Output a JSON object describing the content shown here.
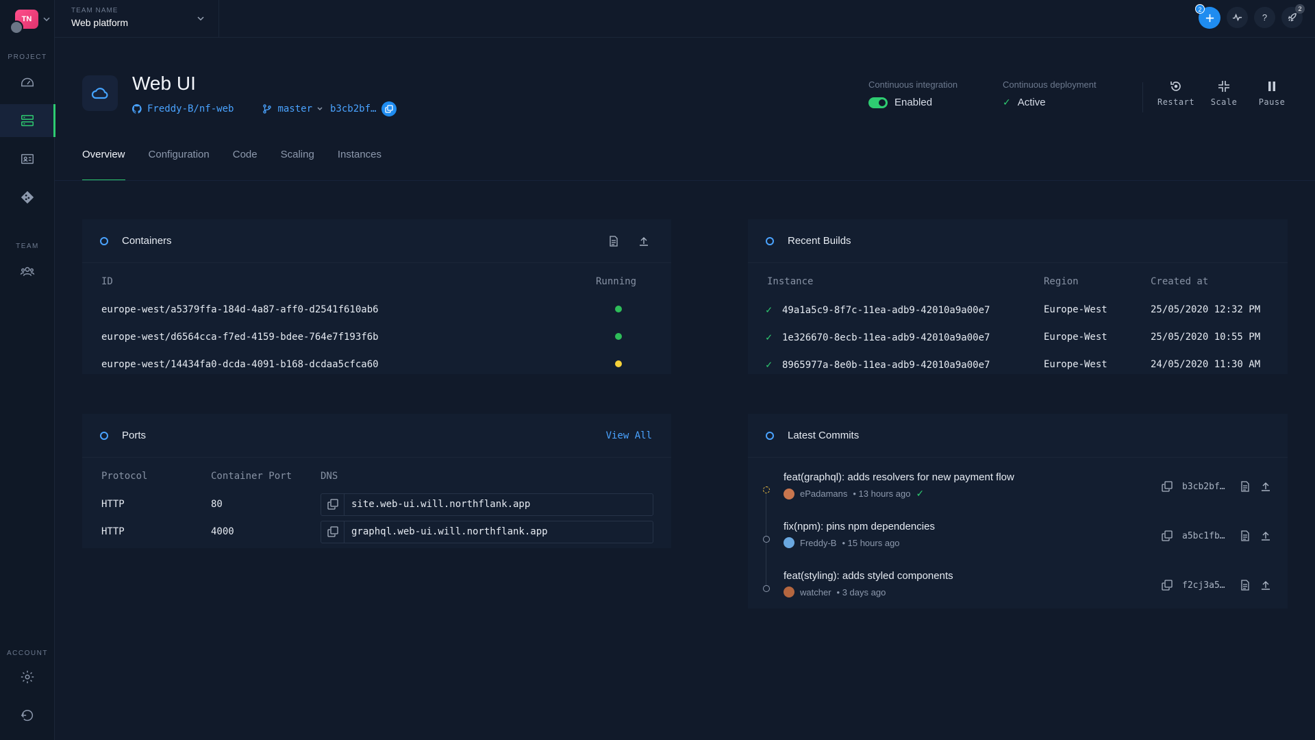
{
  "sidebar": {
    "team_initials": "TN",
    "project_label": "PROJECT",
    "team_label": "TEAM",
    "account_label": "ACCOUNT"
  },
  "topbar": {
    "team_name_label": "TEAM NAME",
    "team_name": "Web platform",
    "add_badge": "2",
    "help_glyph": "?",
    "notifications_badge": "2"
  },
  "service": {
    "title": "Web UI",
    "repo": "Freddy-B/nf-web",
    "branch": "master",
    "commit": "b3cb2bf…"
  },
  "status": {
    "ci_label": "Continuous integration",
    "ci_value": "Enabled",
    "cd_label": "Continuous deployment",
    "cd_value": "Active",
    "check_mark": "✓"
  },
  "header_actions": {
    "restart": "Restart",
    "scale": "Scale",
    "pause": "Pause"
  },
  "tabs": [
    {
      "label": "Overview",
      "active": true
    },
    {
      "label": "Configuration"
    },
    {
      "label": "Code"
    },
    {
      "label": "Scaling"
    },
    {
      "label": "Instances"
    }
  ],
  "containers": {
    "title": "Containers",
    "col_id": "ID",
    "col_running": "Running",
    "rows": [
      {
        "id": "europe-west/a5379ffa-184d-4a87-aff0-d2541f610ab6",
        "status_color": "#2ebd59"
      },
      {
        "id": "europe-west/d6564cca-f7ed-4159-bdee-764e7f193f6b",
        "status_color": "#2ebd59"
      },
      {
        "id": "europe-west/14434fa0-dcda-4091-b168-dcdaa5cfca60",
        "status_color": "#f5d13a"
      }
    ]
  },
  "ports": {
    "title": "Ports",
    "view_all": "View All",
    "col_protocol": "Protocol",
    "col_port": "Container Port",
    "col_dns": "DNS",
    "rows": [
      {
        "protocol": "HTTP",
        "port": "80",
        "dns": "site.web-ui.will.northflank.app"
      },
      {
        "protocol": "HTTP",
        "port": "4000",
        "dns": "graphql.web-ui.will.northflank.app"
      }
    ]
  },
  "builds": {
    "title": "Recent Builds",
    "col_instance": "Instance",
    "col_region": "Region",
    "col_created": "Created at",
    "check_mark": "✓",
    "rows": [
      {
        "instance": "49a1a5c9-8f7c-11ea-adb9-42010a9a00e7",
        "region": "Europe-West",
        "created": "25/05/2020 12:32 PM"
      },
      {
        "instance": "1e326670-8ecb-11ea-adb9-42010a9a00e7",
        "region": "Europe-West",
        "created": "25/05/2020 10:55 PM"
      },
      {
        "instance": "8965977a-8e0b-11ea-adb9-42010a9a00e7",
        "region": "Europe-West",
        "created": "24/05/2020 11:30 AM"
      }
    ]
  },
  "commits": {
    "title": "Latest Commits",
    "check_mark": "✓",
    "rows": [
      {
        "message": "feat(graphql): adds resolvers for new payment flow",
        "author": "ePadamans",
        "time": "• 13 hours ago",
        "sha": "b3cb2bf…",
        "avatar_color": "#c9764e"
      },
      {
        "message": "fix(npm): pins npm dependencies",
        "author": "Freddy-B",
        "time": "• 15 hours ago",
        "sha": "a5bc1fb…",
        "avatar_color": "#6aa8e0"
      },
      {
        "message": "feat(styling): adds styled components",
        "author": "watcher",
        "time": "• 3 days ago",
        "sha": "f2cj3a5…",
        "avatar_color": "#b4663f"
      }
    ]
  }
}
